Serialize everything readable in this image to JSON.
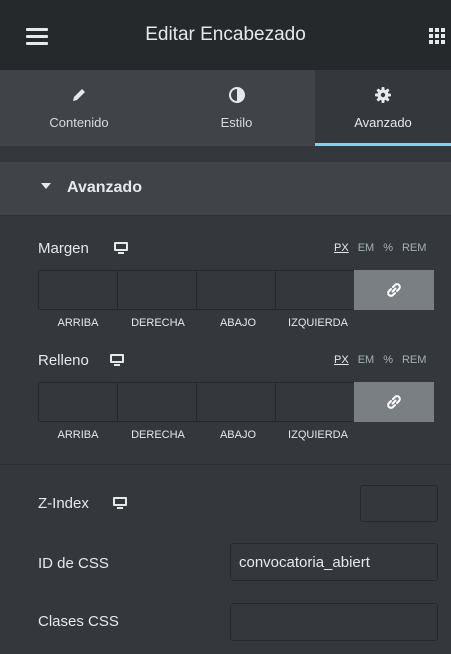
{
  "header": {
    "title": "Editar Encabezado",
    "menu_icon": "hamburger-icon",
    "apps_icon": "grid-icon"
  },
  "tabs": [
    {
      "label": "Contenido",
      "icon": "pencil-icon",
      "active": false
    },
    {
      "label": "Estilo",
      "icon": "contrast-icon",
      "active": false
    },
    {
      "label": "Avanzado",
      "icon": "gear-icon",
      "active": true
    }
  ],
  "section": {
    "title": "Avanzado",
    "icon": "caret-down-icon"
  },
  "margin": {
    "label": "Margen",
    "device_icon": "desktop-icon",
    "units": [
      "PX",
      "EM",
      "%",
      "REM"
    ],
    "selected_unit": "PX",
    "values": {
      "top": "",
      "right": "",
      "bottom": "",
      "left": ""
    },
    "sides": [
      "ARRIBA",
      "DERECHA",
      "ABAJO",
      "IZQUIERDA"
    ]
  },
  "padding": {
    "label": "Relleno",
    "device_icon": "desktop-icon",
    "units": [
      "PX",
      "EM",
      "%",
      "REM"
    ],
    "selected_unit": "PX",
    "values": {
      "top": "",
      "right": "",
      "bottom": "",
      "left": ""
    },
    "sides": [
      "ARRIBA",
      "DERECHA",
      "ABAJO",
      "IZQUIERDA"
    ]
  },
  "zindex": {
    "label": "Z-Index",
    "value": ""
  },
  "css_id": {
    "label": "ID de CSS",
    "value": "convocatoria_abiert"
  },
  "css_classes": {
    "label": "Clases CSS",
    "value": ""
  },
  "colors": {
    "header_bg": "#26292c",
    "panel_bg": "#34383c",
    "tab_bg": "#404449",
    "accent": "#71d7f7",
    "link_btn": "#7a7f83"
  }
}
